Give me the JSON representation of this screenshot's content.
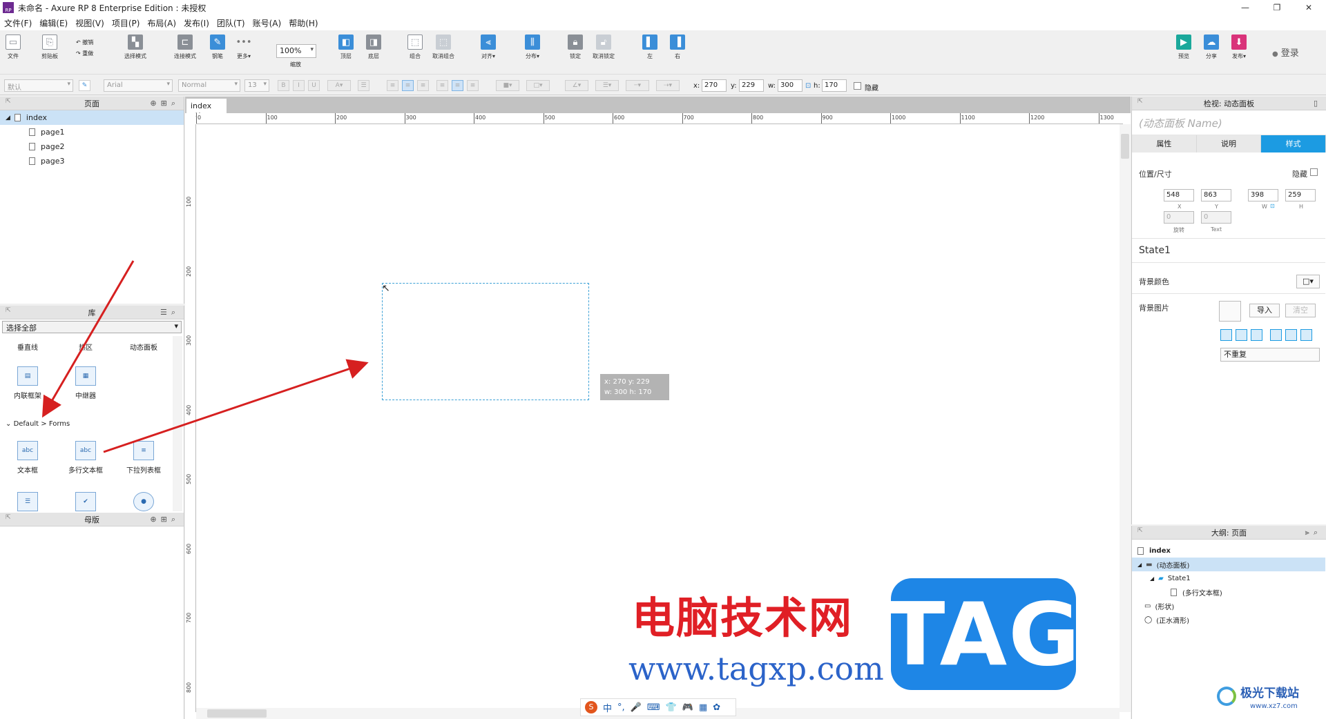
{
  "window": {
    "title": "未命名 - Axure RP 8 Enterprise Edition : 未授权",
    "logo_text": "RP"
  },
  "menu": [
    "文件(F)",
    "编辑(E)",
    "视图(V)",
    "项目(P)",
    "布局(A)",
    "发布(I)",
    "团队(T)",
    "账号(A)",
    "帮助(H)"
  ],
  "toolbar": {
    "file": "文件",
    "clipboard": "剪贴板",
    "undo": "撤销",
    "redo": "重做",
    "select_mode": "选择模式",
    "connect_mode": "连接模式",
    "pen": "钢笔",
    "more": "更多▾",
    "zoom_value": "100%",
    "zoom_label": "缩放",
    "top": "顶层",
    "bottom": "底层",
    "group": "组合",
    "ungroup": "取消组合",
    "align": "对齐▾",
    "distribute": "分布▾",
    "lock": "锁定",
    "unlock": "取消锁定",
    "left": "左",
    "right": "右",
    "preview": "预览",
    "share": "分享",
    "publish": "发布▾",
    "login": "登录"
  },
  "formatbar": {
    "style": "默认",
    "font": "Arial",
    "weight": "Normal",
    "size": "13",
    "x_label": "x:",
    "x": "270",
    "y_label": "y:",
    "y": "229",
    "w_label": "w:",
    "w": "300",
    "h_label": "h:",
    "h": "170",
    "hidden": "隐藏"
  },
  "pages_panel": {
    "title": "页面",
    "items": [
      "index",
      "page1",
      "page2",
      "page3"
    ]
  },
  "library_panel": {
    "title": "库",
    "select": "选择全部",
    "row0": [
      "垂直线",
      "热区",
      "动态面板"
    ],
    "row1": [
      "内联框架",
      "中继器"
    ],
    "section": "Default > Forms",
    "row2": [
      "文本框",
      "多行文本框",
      "下拉列表框"
    ],
    "row2_icons": [
      "abc",
      "abc",
      "≡"
    ]
  },
  "masters_panel": {
    "title": "母版"
  },
  "canvas": {
    "tab": "index",
    "ruler_h": [
      "0",
      "100",
      "200",
      "300",
      "400",
      "500",
      "600",
      "700",
      "800",
      "900",
      "1000",
      "1100",
      "1200",
      "1300"
    ],
    "ruler_v": [
      "100",
      "200",
      "300",
      "400",
      "500",
      "600",
      "700",
      "800"
    ],
    "tooltip_l1": "x: 270    y: 229",
    "tooltip_l2": "w: 300   h: 170"
  },
  "inspector": {
    "title": "检视: 动态面板",
    "name_placeholder": "(动态面板 Name)",
    "tabs": [
      "属性",
      "说明",
      "样式"
    ],
    "pos_size": "位置/尺寸",
    "hidden": "隐藏",
    "x": "548",
    "y": "863",
    "w": "398",
    "h": "259",
    "x_lbl": "X",
    "y_lbl": "Y",
    "w_lbl": "W",
    "h_lbl": "H",
    "rotation": "0",
    "text_rotation": "0",
    "rotation_lbl": "旋转",
    "text_lbl": "Text",
    "state": "State1",
    "bg_color": "背景颜色",
    "bg_image": "背景图片",
    "import": "导入",
    "clear": "清空",
    "repeat": "不重复"
  },
  "outline_panel": {
    "title": "大纲: 页面",
    "items": [
      "index",
      "(动态面板)",
      "State1",
      "(多行文本框)",
      "(形状)",
      "(正水滴形)"
    ]
  },
  "overlays": {
    "watermark_cn": "电脑技术网",
    "watermark_url": "www.tagxp.com",
    "tag": "TAG",
    "site_name": "极光下载站",
    "site_url": "www.xz7.com",
    "ime": [
      "S",
      "中",
      "°,",
      "🎤",
      "⌨",
      "👕",
      "🎮",
      "▦",
      "✿"
    ]
  },
  "colors": {
    "accent": "#1c9be2",
    "arrow": "#d62020",
    "selection": "#cbe2f6"
  }
}
